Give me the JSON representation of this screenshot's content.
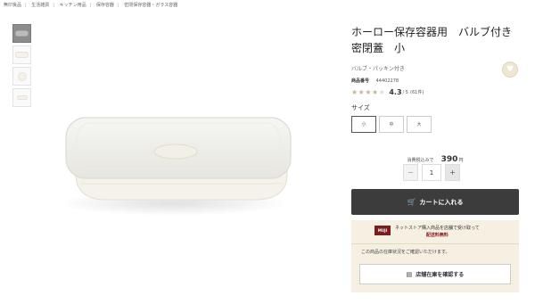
{
  "breadcrumb": [
    "無印良品",
    "生活雑貨",
    "キッチン用品",
    "保存容器",
    "密閉保存容器・ガラス容器"
  ],
  "product": {
    "title": "ホーロー保存容器用　バルブ付き密閉蓋　小",
    "subtitle": "バルブ・パッキン付き",
    "code_label": "商品番号",
    "code": "44402278",
    "rating": "4.3",
    "rating_outof": "/ 5",
    "review_count": "(61件)",
    "stars_filled": 4
  },
  "size": {
    "label": "サイズ",
    "options": [
      "小",
      "中",
      "大"
    ],
    "selected": "小"
  },
  "price": {
    "label": "消費税込みで",
    "value": "390",
    "unit": "円"
  },
  "quantity": {
    "minus": "−",
    "value": "1",
    "plus": "+"
  },
  "cart_button": "カートに入れる",
  "store_pickup": {
    "badge": "MUJI",
    "line1": "ネットストア購入商品を店舗で受け取って",
    "line2": "配送料無料",
    "stock_note": "この商品の在庫状況をご確認いただけます。",
    "stock_button": "店舗在庫を確認する"
  },
  "icons": {
    "favorite": "heart-icon",
    "cart": "cart-icon",
    "shop": "shop-icon"
  },
  "colors": {
    "cart_button": "#3c3c3c",
    "store_box": "#f6f0e3",
    "star": "#c7b59a",
    "accent": "#7a1d1d"
  }
}
